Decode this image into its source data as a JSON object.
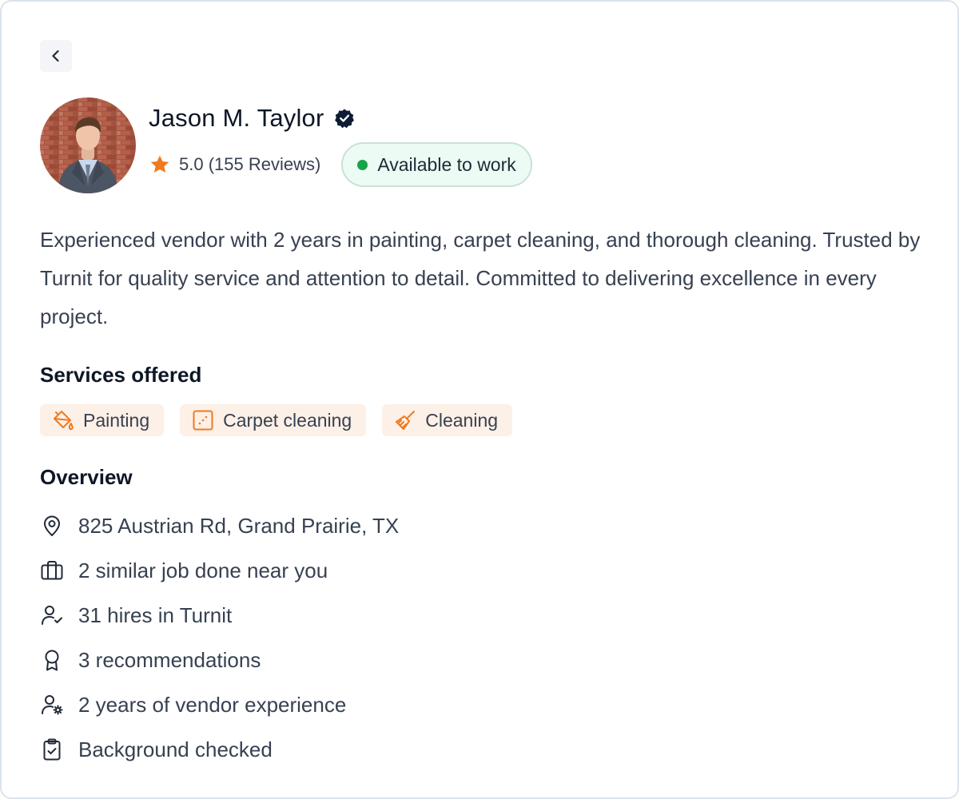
{
  "profile": {
    "name": "Jason M. Taylor",
    "rating_text": "5.0 (155 Reviews)",
    "availability": "Available to work",
    "bio": "Experienced vendor with 2 years in painting, carpet cleaning, and thorough cleaning. Trusted by Turnit for quality service and attention to detail. Committed to delivering excellence in every project."
  },
  "services": {
    "title": "Services offered",
    "items": [
      {
        "label": "Painting",
        "icon": "paint-bucket-icon"
      },
      {
        "label": "Carpet cleaning",
        "icon": "carpet-icon"
      },
      {
        "label": "Cleaning",
        "icon": "broom-icon"
      }
    ]
  },
  "overview": {
    "title": "Overview",
    "items": [
      {
        "text": "825 Austrian Rd, Grand Prairie, TX",
        "icon": "location-pin-icon"
      },
      {
        "text": "2 similar job done near you",
        "icon": "briefcase-icon"
      },
      {
        "text": "31 hires in Turnit",
        "icon": "user-check-icon"
      },
      {
        "text": "3 recommendations",
        "icon": "award-icon"
      },
      {
        "text": "2 years of vendor experience",
        "icon": "user-gear-icon"
      },
      {
        "text": "Background checked",
        "icon": "clipboard-check-icon"
      }
    ]
  },
  "colors": {
    "accent": "#f07a1e",
    "available_dot": "#17a34a",
    "chip_bg": "#fdf0e7",
    "verified": "#0e1b33"
  }
}
